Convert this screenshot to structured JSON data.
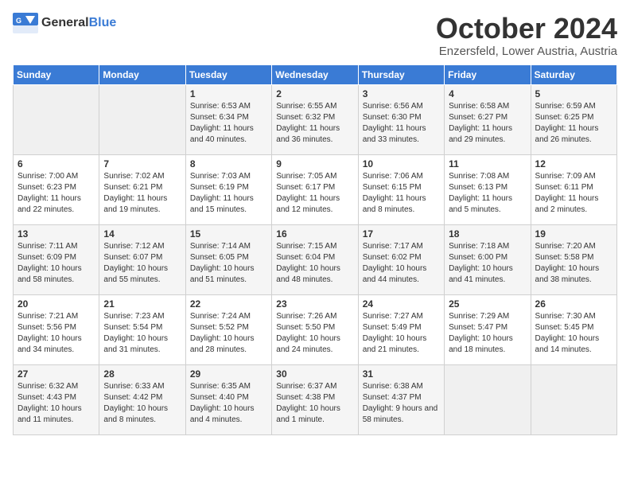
{
  "header": {
    "logo": {
      "general": "General",
      "blue": "Blue"
    },
    "month": "October 2024",
    "location": "Enzersfeld, Lower Austria, Austria"
  },
  "weekdays": [
    "Sunday",
    "Monday",
    "Tuesday",
    "Wednesday",
    "Thursday",
    "Friday",
    "Saturday"
  ],
  "weeks": [
    [
      {
        "day": "",
        "sunrise": "",
        "sunset": "",
        "daylight": "",
        "empty": true
      },
      {
        "day": "",
        "sunrise": "",
        "sunset": "",
        "daylight": "",
        "empty": true
      },
      {
        "day": "1",
        "sunrise": "Sunrise: 6:53 AM",
        "sunset": "Sunset: 6:34 PM",
        "daylight": "Daylight: 11 hours and 40 minutes."
      },
      {
        "day": "2",
        "sunrise": "Sunrise: 6:55 AM",
        "sunset": "Sunset: 6:32 PM",
        "daylight": "Daylight: 11 hours and 36 minutes."
      },
      {
        "day": "3",
        "sunrise": "Sunrise: 6:56 AM",
        "sunset": "Sunset: 6:30 PM",
        "daylight": "Daylight: 11 hours and 33 minutes."
      },
      {
        "day": "4",
        "sunrise": "Sunrise: 6:58 AM",
        "sunset": "Sunset: 6:27 PM",
        "daylight": "Daylight: 11 hours and 29 minutes."
      },
      {
        "day": "5",
        "sunrise": "Sunrise: 6:59 AM",
        "sunset": "Sunset: 6:25 PM",
        "daylight": "Daylight: 11 hours and 26 minutes."
      }
    ],
    [
      {
        "day": "6",
        "sunrise": "Sunrise: 7:00 AM",
        "sunset": "Sunset: 6:23 PM",
        "daylight": "Daylight: 11 hours and 22 minutes."
      },
      {
        "day": "7",
        "sunrise": "Sunrise: 7:02 AM",
        "sunset": "Sunset: 6:21 PM",
        "daylight": "Daylight: 11 hours and 19 minutes."
      },
      {
        "day": "8",
        "sunrise": "Sunrise: 7:03 AM",
        "sunset": "Sunset: 6:19 PM",
        "daylight": "Daylight: 11 hours and 15 minutes."
      },
      {
        "day": "9",
        "sunrise": "Sunrise: 7:05 AM",
        "sunset": "Sunset: 6:17 PM",
        "daylight": "Daylight: 11 hours and 12 minutes."
      },
      {
        "day": "10",
        "sunrise": "Sunrise: 7:06 AM",
        "sunset": "Sunset: 6:15 PM",
        "daylight": "Daylight: 11 hours and 8 minutes."
      },
      {
        "day": "11",
        "sunrise": "Sunrise: 7:08 AM",
        "sunset": "Sunset: 6:13 PM",
        "daylight": "Daylight: 11 hours and 5 minutes."
      },
      {
        "day": "12",
        "sunrise": "Sunrise: 7:09 AM",
        "sunset": "Sunset: 6:11 PM",
        "daylight": "Daylight: 11 hours and 2 minutes."
      }
    ],
    [
      {
        "day": "13",
        "sunrise": "Sunrise: 7:11 AM",
        "sunset": "Sunset: 6:09 PM",
        "daylight": "Daylight: 10 hours and 58 minutes."
      },
      {
        "day": "14",
        "sunrise": "Sunrise: 7:12 AM",
        "sunset": "Sunset: 6:07 PM",
        "daylight": "Daylight: 10 hours and 55 minutes."
      },
      {
        "day": "15",
        "sunrise": "Sunrise: 7:14 AM",
        "sunset": "Sunset: 6:05 PM",
        "daylight": "Daylight: 10 hours and 51 minutes."
      },
      {
        "day": "16",
        "sunrise": "Sunrise: 7:15 AM",
        "sunset": "Sunset: 6:04 PM",
        "daylight": "Daylight: 10 hours and 48 minutes."
      },
      {
        "day": "17",
        "sunrise": "Sunrise: 7:17 AM",
        "sunset": "Sunset: 6:02 PM",
        "daylight": "Daylight: 10 hours and 44 minutes."
      },
      {
        "day": "18",
        "sunrise": "Sunrise: 7:18 AM",
        "sunset": "Sunset: 6:00 PM",
        "daylight": "Daylight: 10 hours and 41 minutes."
      },
      {
        "day": "19",
        "sunrise": "Sunrise: 7:20 AM",
        "sunset": "Sunset: 5:58 PM",
        "daylight": "Daylight: 10 hours and 38 minutes."
      }
    ],
    [
      {
        "day": "20",
        "sunrise": "Sunrise: 7:21 AM",
        "sunset": "Sunset: 5:56 PM",
        "daylight": "Daylight: 10 hours and 34 minutes."
      },
      {
        "day": "21",
        "sunrise": "Sunrise: 7:23 AM",
        "sunset": "Sunset: 5:54 PM",
        "daylight": "Daylight: 10 hours and 31 minutes."
      },
      {
        "day": "22",
        "sunrise": "Sunrise: 7:24 AM",
        "sunset": "Sunset: 5:52 PM",
        "daylight": "Daylight: 10 hours and 28 minutes."
      },
      {
        "day": "23",
        "sunrise": "Sunrise: 7:26 AM",
        "sunset": "Sunset: 5:50 PM",
        "daylight": "Daylight: 10 hours and 24 minutes."
      },
      {
        "day": "24",
        "sunrise": "Sunrise: 7:27 AM",
        "sunset": "Sunset: 5:49 PM",
        "daylight": "Daylight: 10 hours and 21 minutes."
      },
      {
        "day": "25",
        "sunrise": "Sunrise: 7:29 AM",
        "sunset": "Sunset: 5:47 PM",
        "daylight": "Daylight: 10 hours and 18 minutes."
      },
      {
        "day": "26",
        "sunrise": "Sunrise: 7:30 AM",
        "sunset": "Sunset: 5:45 PM",
        "daylight": "Daylight: 10 hours and 14 minutes."
      }
    ],
    [
      {
        "day": "27",
        "sunrise": "Sunrise: 6:32 AM",
        "sunset": "Sunset: 4:43 PM",
        "daylight": "Daylight: 10 hours and 11 minutes."
      },
      {
        "day": "28",
        "sunrise": "Sunrise: 6:33 AM",
        "sunset": "Sunset: 4:42 PM",
        "daylight": "Daylight: 10 hours and 8 minutes."
      },
      {
        "day": "29",
        "sunrise": "Sunrise: 6:35 AM",
        "sunset": "Sunset: 4:40 PM",
        "daylight": "Daylight: 10 hours and 4 minutes."
      },
      {
        "day": "30",
        "sunrise": "Sunrise: 6:37 AM",
        "sunset": "Sunset: 4:38 PM",
        "daylight": "Daylight: 10 hours and 1 minute."
      },
      {
        "day": "31",
        "sunrise": "Sunrise: 6:38 AM",
        "sunset": "Sunset: 4:37 PM",
        "daylight": "Daylight: 9 hours and 58 minutes."
      },
      {
        "day": "",
        "sunrise": "",
        "sunset": "",
        "daylight": "",
        "empty": true
      },
      {
        "day": "",
        "sunrise": "",
        "sunset": "",
        "daylight": "",
        "empty": true
      }
    ]
  ]
}
